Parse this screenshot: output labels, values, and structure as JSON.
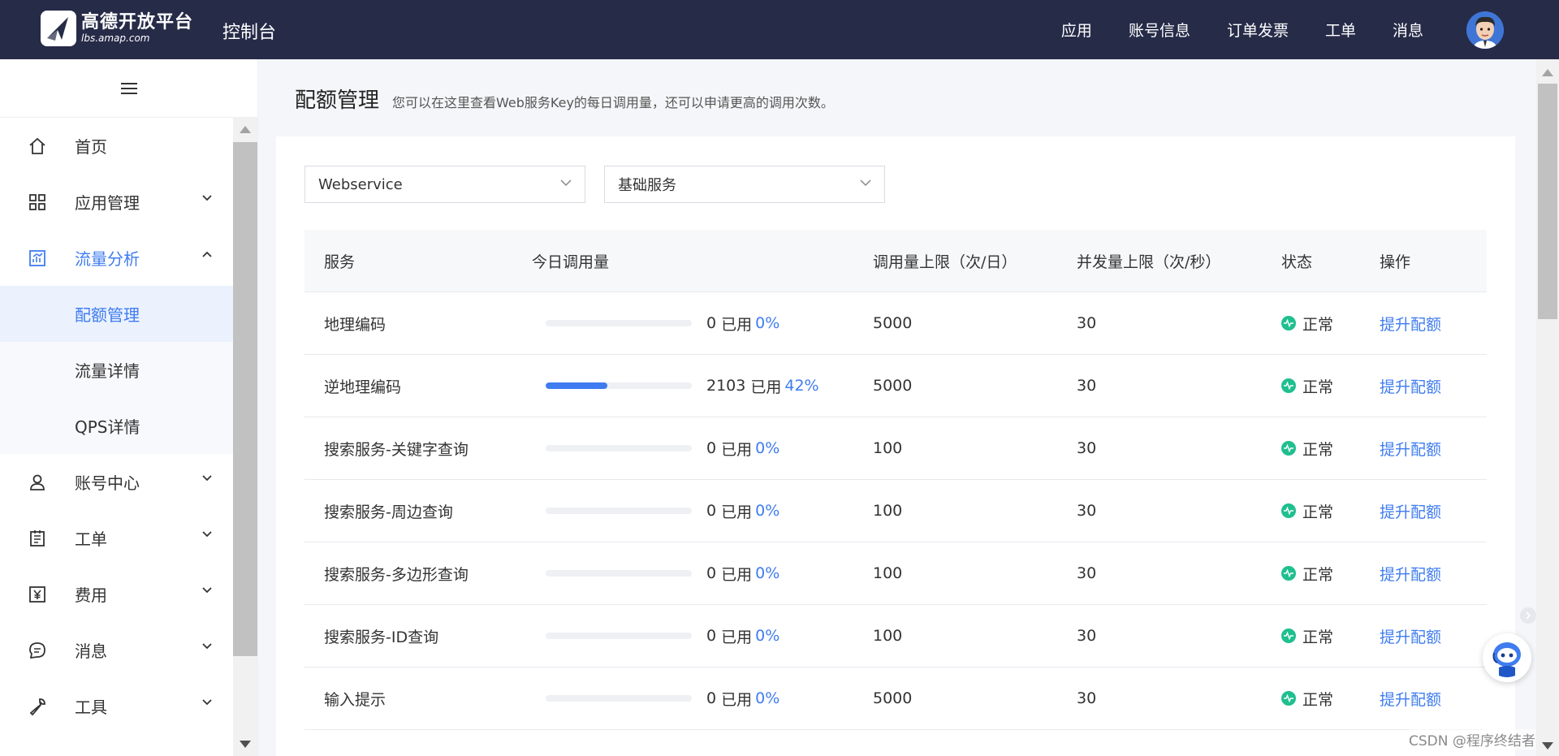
{
  "header": {
    "logo_line1": "高德开放平台",
    "logo_line2": "lbs.amap.com",
    "console_title": "控制台",
    "nav": [
      "应用",
      "账号信息",
      "订单发票",
      "工单",
      "消息"
    ]
  },
  "sidebar": {
    "items": [
      {
        "label": "首页",
        "icon": "home-icon"
      },
      {
        "label": "应用管理",
        "icon": "grid-icon"
      },
      {
        "label": "流量分析",
        "icon": "chart-icon"
      },
      {
        "label": "账号中心",
        "icon": "user-icon"
      },
      {
        "label": "工单",
        "icon": "ticket-icon"
      },
      {
        "label": "费用",
        "icon": "yuan-icon"
      },
      {
        "label": "消息",
        "icon": "message-icon"
      },
      {
        "label": "工具",
        "icon": "wrench-icon"
      }
    ],
    "sub_items": [
      "配额管理",
      "流量详情",
      "QPS详情"
    ]
  },
  "page": {
    "title": "配额管理",
    "description": "您可以在这里查看Web服务Key的每日调用量，还可以申请更高的调用次数。"
  },
  "filters": {
    "type_select": "Webservice",
    "service_select": "基础服务"
  },
  "table": {
    "headers": [
      "服务",
      "今日调用量",
      "调用量上限（次/日）",
      "并发量上限（次/秒）",
      "状态",
      "操作"
    ],
    "used_label": "已用",
    "rows": [
      {
        "service": "地理编码",
        "used": "0",
        "percent": "0%",
        "pct": 0,
        "limit": "5000",
        "qps": "30",
        "status": "正常",
        "action": "提升配额"
      },
      {
        "service": "逆地理编码",
        "used": "2103",
        "percent": "42%",
        "pct": 42,
        "limit": "5000",
        "qps": "30",
        "status": "正常",
        "action": "提升配额"
      },
      {
        "service": "搜索服务-关键字查询",
        "used": "0",
        "percent": "0%",
        "pct": 0,
        "limit": "100",
        "qps": "30",
        "status": "正常",
        "action": "提升配额"
      },
      {
        "service": "搜索服务-周边查询",
        "used": "0",
        "percent": "0%",
        "pct": 0,
        "limit": "100",
        "qps": "30",
        "status": "正常",
        "action": "提升配额"
      },
      {
        "service": "搜索服务-多边形查询",
        "used": "0",
        "percent": "0%",
        "pct": 0,
        "limit": "100",
        "qps": "30",
        "status": "正常",
        "action": "提升配额"
      },
      {
        "service": "搜索服务-ID查询",
        "used": "0",
        "percent": "0%",
        "pct": 0,
        "limit": "100",
        "qps": "30",
        "status": "正常",
        "action": "提升配额"
      },
      {
        "service": "输入提示",
        "used": "0",
        "percent": "0%",
        "pct": 0,
        "limit": "5000",
        "qps": "30",
        "status": "正常",
        "action": "提升配额"
      }
    ]
  },
  "watermark": "CSDN @程序终结者",
  "colors": {
    "header_bg": "#262b48",
    "accent": "#3f7cf0",
    "status_ok": "#1fbf8f"
  }
}
